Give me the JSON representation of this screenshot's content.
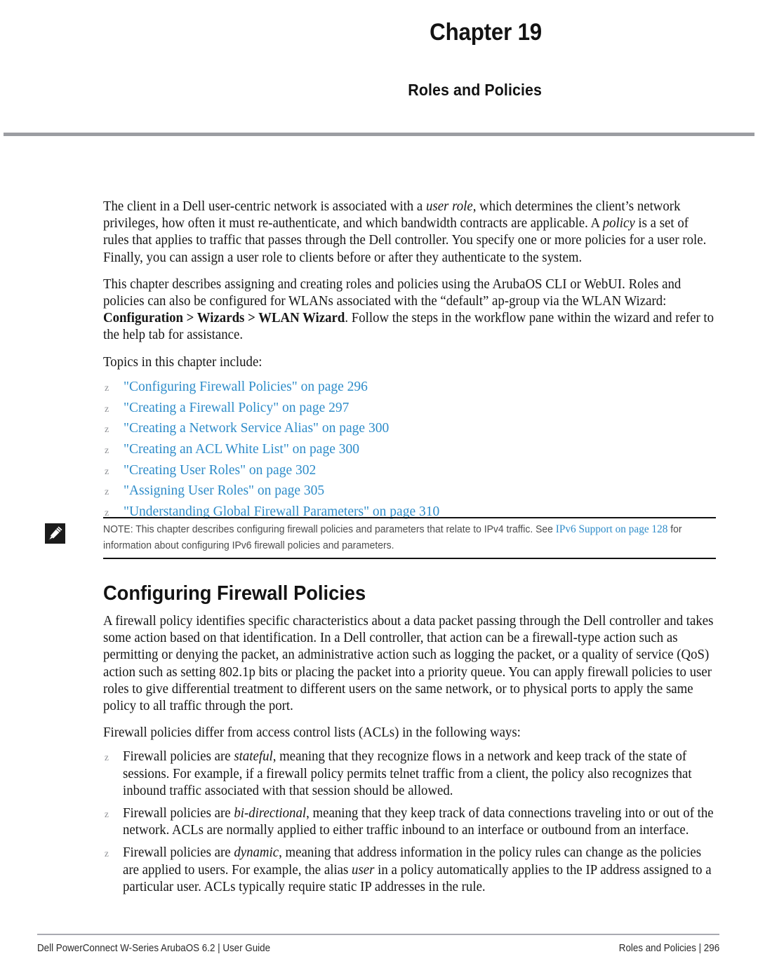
{
  "header": {
    "chapter_number": "Chapter 19",
    "chapter_title": "Roles and Policies"
  },
  "intro": {
    "paragraph1_part1": "The client in a  Dell user-centric network is associated with a ",
    "paragraph1_italic1": "user role",
    "paragraph1_part2": ", which determines the client’s network privileges, how often it must re-authenticate, and which bandwidth contracts are applicable. A ",
    "paragraph1_italic2": "policy",
    "paragraph1_part3": " is a set of rules that applies to traffic that passes through the Dell  controller. You specify one or more policies for a user role. Finally, you can assign a user role to clients before or after they authenticate to the system.",
    "paragraph2_part1": "This chapter describes assigning and creating roles and policies using the ArubaOS CLI or WebUI. Roles and policies can also be configured for WLANs associated with the “default” ap-group via the WLAN Wizard: ",
    "paragraph2_bold": "Configuration > Wizards > WLAN Wizard",
    "paragraph2_part2": ". Follow the steps in the workflow pane within the wizard and refer to the help tab for assistance.",
    "topics_lead": "Topics in this chapter include:"
  },
  "bullet_glyph": "z",
  "topics": [
    "\"Configuring Firewall Policies\" on page 296",
    "\"Creating a Firewall Policy\" on page 297",
    "\"Creating a Network Service Alias\" on page 300",
    "\"Creating an ACL White List\" on page 300",
    "\"Creating User Roles\" on page 302",
    "\"Assigning User Roles\" on page 305",
    "\"Understanding Global Firewall Parameters\" on page 310"
  ],
  "note": {
    "text_part1": "NOTE: This  chapter describes configuring firewall policies and parameters that relate to IPv4 traffic. See ",
    "link": "IPv6 Support on page 128",
    "text_part2": " for information about configuring IPv6 firewall policies and parameters."
  },
  "section": {
    "heading": "Configuring Firewall Policies",
    "paragraph1": "A firewall policy identifies specific characteristics about a data packet passing through the Dell  controller and takes some action based on that identification. In a  Dell  controller, that action can be a firewall-type action such as permitting or denying the packet, an administrative action such as logging the packet, or a quality of service (QoS) action such as setting 802.1p bits or placing the packet into a priority queue. You can apply firewall policies to user roles to give differential treatment to different users on the same network, or to physical ports to apply the same policy to all traffic through the port.",
    "paragraph2": "Firewall policies differ from access control lists (ACLs) in the following ways:"
  },
  "differences": [
    {
      "part1": "Firewall policies are ",
      "italic": "stateful",
      "part2": ", meaning that they recognize flows in a network and keep track of the state of sessions. For example, if a firewall policy permits telnet traffic from a client, the policy also recognizes that inbound traffic associated with that session should be allowed."
    },
    {
      "part1": "Firewall policies are ",
      "italic": "bi-directional",
      "part2": ", meaning that they keep track of data connections traveling into or out of the network. ACLs are normally applied to either traffic inbound to an interface or outbound from an interface."
    },
    {
      "part1": "Firewall policies are ",
      "italic": "dynamic",
      "part2": ", meaning that address information in the policy rules can change as the policies are applied to users. For example, the alias ",
      "italic2": "user",
      "part3": " in a policy automatically applies to the IP address assigned to a particular user. ACLs typically require static IP addresses in the rule."
    }
  ],
  "footer": {
    "left": "Dell PowerConnect W-Series ArubaOS 6.2  |  User Guide",
    "right": "Roles and Policies | 296"
  },
  "colors": {
    "link_blue": "#2e8cc9",
    "rule_grey": "#9b9da2",
    "note_text": "#4c4c4c",
    "body_text": "#161616"
  }
}
